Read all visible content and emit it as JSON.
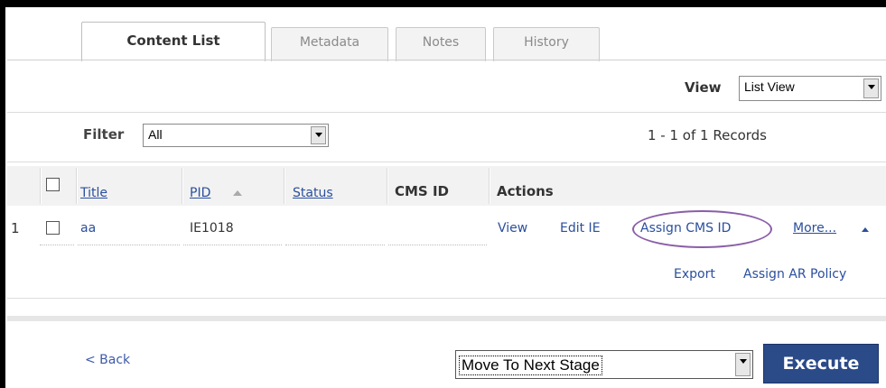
{
  "tabs": [
    {
      "label": "Content List",
      "active": true
    },
    {
      "label": "Metadata",
      "active": false
    },
    {
      "label": "Notes",
      "active": false
    },
    {
      "label": "History",
      "active": false
    }
  ],
  "view": {
    "label": "View",
    "selected": "List View"
  },
  "filter": {
    "label": "Filter",
    "selected": "All"
  },
  "records": "1 - 1 of 1 Records",
  "table": {
    "columns": [
      "Title",
      "PID",
      "Status",
      "CMS ID",
      "Actions"
    ],
    "rows": [
      {
        "num": "1",
        "title": "aa",
        "pid": "IE1018",
        "status": "",
        "cms_id": "",
        "actions": {
          "view": "View",
          "edit": "Edit IE",
          "assign": "Assign CMS ID",
          "more": "More..."
        }
      }
    ]
  },
  "bulk_actions": {
    "export": "Export",
    "assign_ar": "Assign AR Policy"
  },
  "footer": {
    "back": "< Back",
    "stage_select": "Move To Next Stage",
    "execute": "Execute"
  },
  "colors": {
    "link": "#2a4f9d",
    "execute_bg": "#2a4a88",
    "highlight_oval": "#8a5ea8"
  }
}
